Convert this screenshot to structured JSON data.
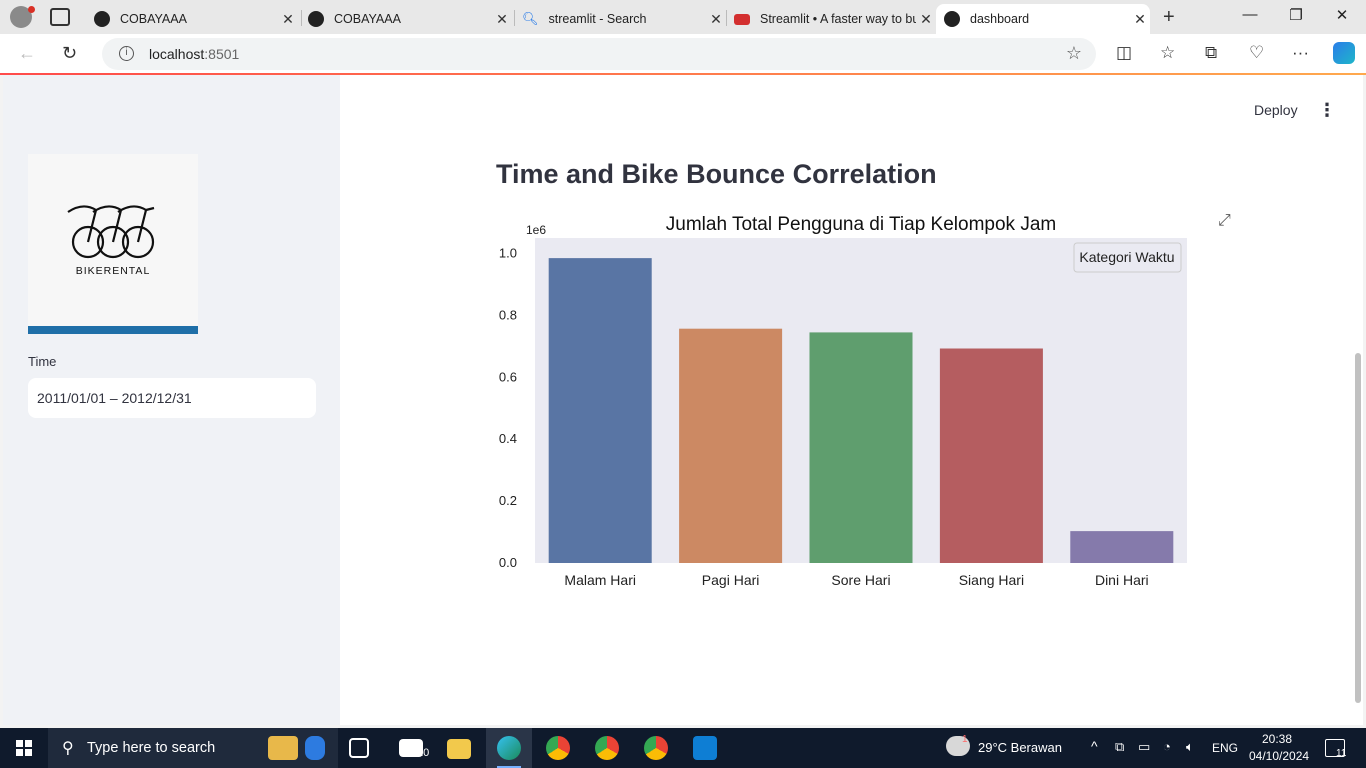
{
  "browser": {
    "tabs": [
      {
        "title": "COBAYAAA",
        "icon": "streamlit-favicon"
      },
      {
        "title": "COBAYAAA",
        "icon": "streamlit-favicon"
      },
      {
        "title": "streamlit - Search",
        "icon": "search-favicon"
      },
      {
        "title": "Streamlit • A faster way to bu",
        "icon": "streamlit-crown-favicon"
      },
      {
        "title": "dashboard",
        "icon": "streamlit-favicon"
      }
    ],
    "active_tab_index": 4,
    "url_host": "localhost",
    "url_port": ":8501"
  },
  "sidebar": {
    "logo_text": "BIKERENTAL",
    "time_label": "Time",
    "date_range": "2011/01/01 – 2012/12/31"
  },
  "main": {
    "deploy_label": "Deploy",
    "heading": "Time and Bike Bounce Correlation"
  },
  "chart_data": {
    "type": "bar",
    "title": "Jumlah Total Pengguna di Tiap Kelompok Jam",
    "xlabel": "",
    "ylabel": "",
    "y_offset_label": "1e6",
    "legend_title": "Kategori Waktu",
    "legend_position": "top-right",
    "categories": [
      "Malam Hari",
      "Pagi Hari",
      "Sore Hari",
      "Siang Hari",
      "Dini Hari"
    ],
    "values": [
      985000,
      757000,
      745000,
      693000,
      103000
    ],
    "colors": [
      "#5975a4",
      "#cc8963",
      "#5f9e6e",
      "#b55d60",
      "#857aab"
    ],
    "yticks": [
      "0.0",
      "0.2",
      "0.4",
      "0.6",
      "0.8",
      "1.0"
    ],
    "ylim": [
      0,
      1050000
    ],
    "background": "#eaeaf2"
  },
  "taskbar": {
    "search_placeholder": "Type here to search",
    "mail_badge": "10",
    "weather": "29°C  Berawan",
    "weather_badge": "1",
    "language": "ENG",
    "time": "20:38",
    "date": "04/10/2024",
    "notification_count": "11"
  }
}
